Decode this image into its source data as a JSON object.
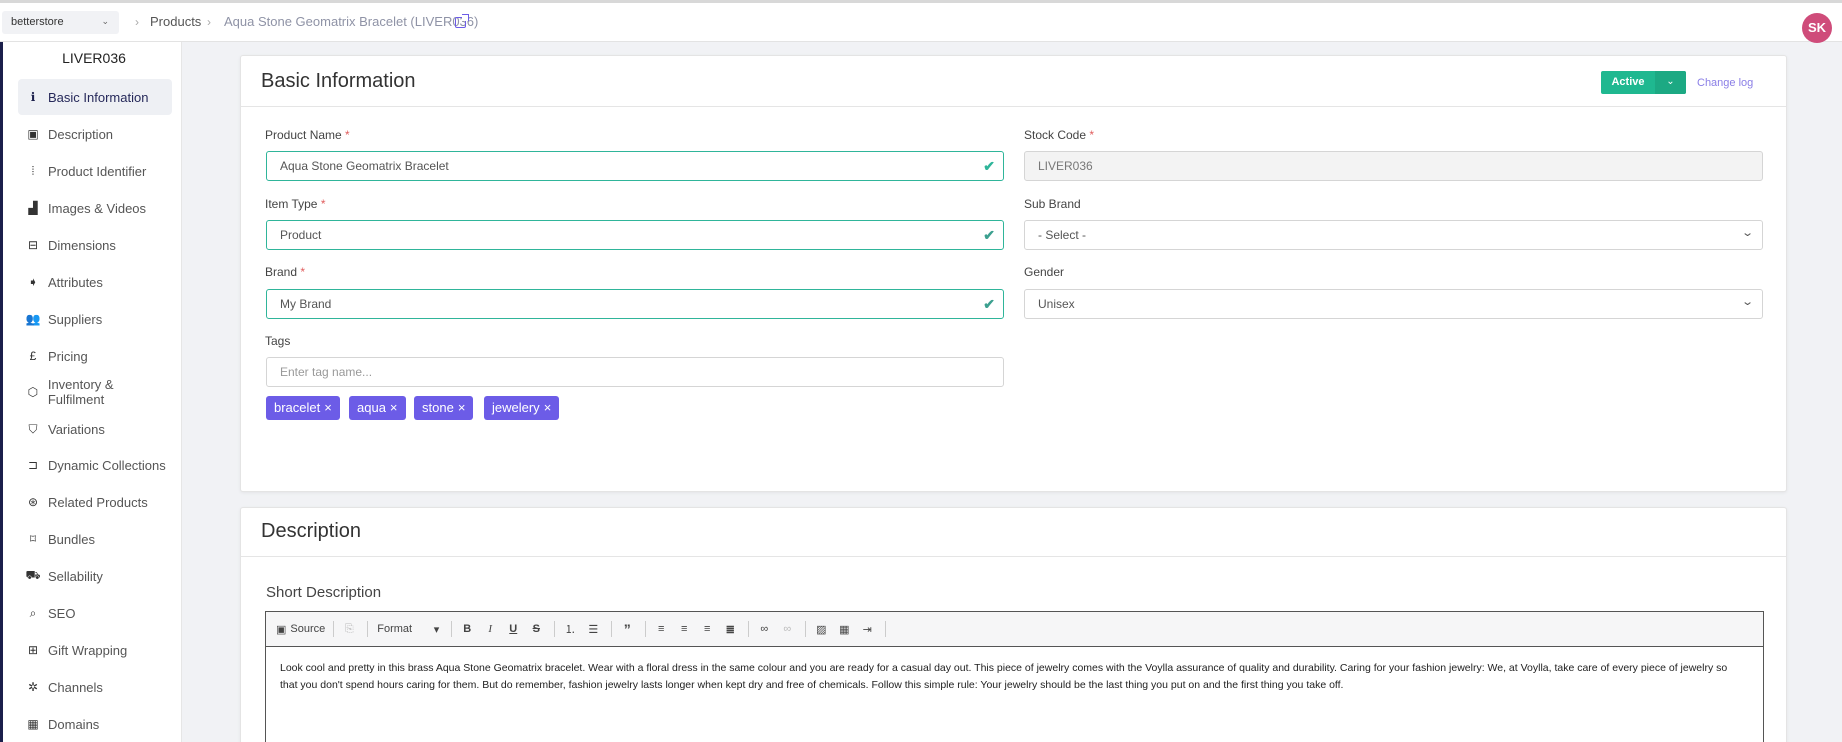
{
  "topbar": {
    "store": "betterstore",
    "breadcrumbs": [
      "Products",
      "Aqua Stone Geomatrix Bracelet (LIVER036)"
    ],
    "avatar_initials": "SK"
  },
  "sidebar": {
    "sku": "LIVER036",
    "items": [
      {
        "label": "Basic Information",
        "icon": "info-icon",
        "glyph": "ℹ",
        "active": true
      },
      {
        "label": "Description",
        "icon": "text-box-icon",
        "glyph": "▣"
      },
      {
        "label": "Product Identifier",
        "icon": "barcode-icon",
        "glyph": "⦙"
      },
      {
        "label": "Images & Videos",
        "icon": "image-add-icon",
        "glyph": "▟"
      },
      {
        "label": "Dimensions",
        "icon": "dimensions-icon",
        "glyph": "⊟"
      },
      {
        "label": "Attributes",
        "icon": "tag-icon",
        "glyph": "➧"
      },
      {
        "label": "Suppliers",
        "icon": "people-icon",
        "glyph": "👥"
      },
      {
        "label": "Pricing",
        "icon": "pound-icon",
        "glyph": "£"
      },
      {
        "label": "Inventory & Fulfilment",
        "icon": "box-icon",
        "glyph": "⬡"
      },
      {
        "label": "Variations",
        "icon": "shirt-icon",
        "glyph": "⛉"
      },
      {
        "label": "Dynamic Collections",
        "icon": "collection-icon",
        "glyph": "⊐"
      },
      {
        "label": "Related Products",
        "icon": "star-circle-icon",
        "glyph": "⊛"
      },
      {
        "label": "Bundles",
        "icon": "bundle-icon",
        "glyph": "⌑"
      },
      {
        "label": "Sellability",
        "icon": "cart-icon",
        "glyph": "⛟"
      },
      {
        "label": "SEO",
        "icon": "search-icon",
        "glyph": "⌕"
      },
      {
        "label": "Gift Wrapping",
        "icon": "gift-icon",
        "glyph": "⊞"
      },
      {
        "label": "Channels",
        "icon": "channels-icon",
        "glyph": "✲"
      },
      {
        "label": "Domains",
        "icon": "domains-icon",
        "glyph": "▦"
      }
    ]
  },
  "basic_info": {
    "title": "Basic Information",
    "status": "Active",
    "status_color": "#1fb890",
    "change_log": "Change log",
    "fields": {
      "product_name": {
        "label": "Product Name",
        "value": "Aqua Stone Geomatrix Bracelet"
      },
      "stock_code": {
        "label": "Stock Code",
        "value": "LIVER036"
      },
      "item_type": {
        "label": "Item Type",
        "value": "Product"
      },
      "sub_brand": {
        "label": "Sub Brand",
        "value": "- Select -"
      },
      "brand": {
        "label": "Brand",
        "value": "My Brand"
      },
      "gender": {
        "label": "Gender",
        "value": "Unisex"
      },
      "tags": {
        "label": "Tags",
        "placeholder": "Enter tag name..."
      }
    },
    "required_mark": "*",
    "tags": [
      "bracelet",
      "aqua",
      "stone",
      "jewelery"
    ],
    "tag_color": "#6c5ce7",
    "tag_remove": "×"
  },
  "description": {
    "title": "Description",
    "short_label": "Short Description",
    "toolbar": {
      "source": "Source",
      "format": "Format"
    },
    "text": "Look cool and pretty in this brass Aqua Stone Geomatrix bracelet. Wear with a floral dress in the same colour and you are ready for a casual day out. This piece of jewelry comes with the Voylla assurance of quality and durability. Caring for your fashion jewelry: We, at Voylla, take care of every piece of jewelry so that you don't spend hours caring for them. But do remember, fashion jewelry lasts longer when kept dry and free of chemicals. Follow this simple rule: Your jewelry should be the last thing you put on and the first thing you take off."
  }
}
